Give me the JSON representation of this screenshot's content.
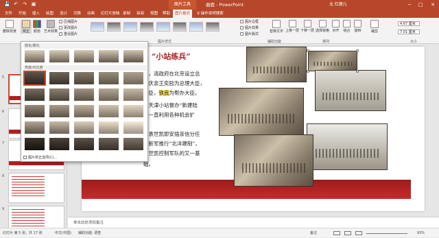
{
  "titlebar": {
    "context_tab": "图片工具",
    "doc_title": "曲面 - PowerPoint",
    "user": "允 红鹿儿",
    "minimize": "−",
    "restore": "□",
    "close": "✕",
    "qat": [
      "💾",
      "↶",
      "↷",
      "▣"
    ],
    "bg_color": "#b7472a"
  },
  "tabs": [
    "文件",
    "开始",
    "插入",
    "绘图",
    "设计",
    "切换",
    "动画",
    "幻灯片放映",
    "录制",
    "审阅",
    "视图",
    "帮助",
    "图片格式",
    "♀ 操作说明搜索"
  ],
  "active_tab": "图片格式",
  "ribbon": {
    "remove_bg": "删除背景",
    "corrections": "校正",
    "color": "颜色",
    "artistic": "艺术效果",
    "compress": "压缩图片",
    "change_pic": "更改图片",
    "reset_pic": "重设图片",
    "styles_group": "图片样式",
    "border": "图片边框",
    "effects": "图片效果",
    "layout": "图片版式",
    "accessibility_group": "辅助功能",
    "alt_text": "替换文字",
    "bring_forward": "上移一层",
    "send_backward": "下移一层",
    "selection_pane": "选择窗格",
    "align": "对齐",
    "group": "组合",
    "rotate": "旋转",
    "arrange_group": "排列",
    "crop": "裁剪",
    "height": "4.67 厘米",
    "width": "7.01 厘米",
    "size_group": "大小"
  },
  "gallery": {
    "section1": "锐化/柔化",
    "section2": "亮度/对比度",
    "footer": "图片校正选项(C)..."
  },
  "slide": {
    "title": "“小站练兵”",
    "lines": [
      "日，清政府在北京设立总",
      "命庆亲王奕劻为总理大臣，",
      "大臣，",
      "铁良",
      "为帮办大臣。",
      "在天津小站督办“新建陆",
      "凯一直利用各种机会扩",
      "，袁世凯即安插亲信分任",
      "国新军推行“北洋建制”，",
      "袁世凯控制军队的又一基",
      "础。"
    ]
  },
  "thumbnails": [
    "5",
    "6",
    "7",
    "8",
    "9"
  ],
  "notes_placeholder": "单击此处添加备注",
  "status": {
    "slide_count": "幻灯片 第 5 张，共 17 张",
    "language": "中文(中国)",
    "accessibility": "辅助功能: 调查",
    "notes": "备注",
    "zoom": "93%"
  }
}
